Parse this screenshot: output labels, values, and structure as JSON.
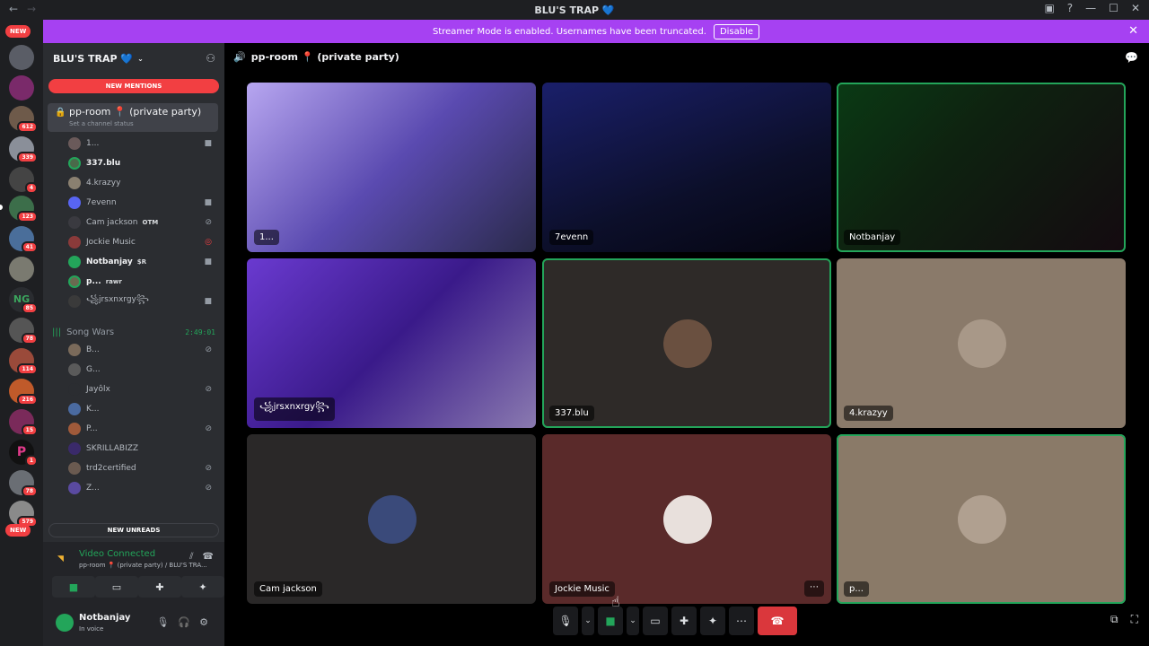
{
  "titlebar": {
    "title": "BLU'S TRAP 💙",
    "back": "←",
    "forward": "→",
    "icons": [
      "inbox-icon",
      "help-icon",
      "minimize-icon",
      "maximize-icon",
      "close-icon"
    ]
  },
  "banner": {
    "text": "Streamer Mode is enabled. Usernames have been truncated.",
    "button": "Disable",
    "close": "✕"
  },
  "guild_bar": {
    "new_top": "NEW",
    "new_bottom": "NEW",
    "badges": [
      "612",
      "339",
      "4",
      "123",
      "41",
      "85",
      "78",
      "114",
      "216",
      "15",
      "1",
      "78",
      "579"
    ]
  },
  "sidebar": {
    "server_name": "BLU'S TRAP 💙",
    "new_mentions": "NEW MENTIONS",
    "current_channel": {
      "name": "pp-room 📍 (private party)",
      "status": "Set a channel status"
    },
    "voice_users": [
      {
        "name": "1...",
        "tag": ""
      },
      {
        "name": "337.blu",
        "tag": ""
      },
      {
        "name": "4.krazyy",
        "tag": ""
      },
      {
        "name": "7evenn",
        "tag": ""
      },
      {
        "name": "Cam jackson",
        "tag": "OTM"
      },
      {
        "name": "Jockie Music",
        "tag": ""
      },
      {
        "name": "Notbanjay",
        "tag": "$R"
      },
      {
        "name": "p...",
        "tag": "rawr"
      },
      {
        "name": "꧁jrsxnxrgy꧂",
        "tag": ""
      }
    ],
    "song_wars": {
      "name": "Song Wars",
      "time": "2:49:01"
    },
    "song_wars_users": [
      {
        "name": "B..."
      },
      {
        "name": "G..."
      },
      {
        "name": "Jayôlx"
      },
      {
        "name": "K..."
      },
      {
        "name": "P..."
      },
      {
        "name": "SKRILLABIZZ"
      },
      {
        "name": "trd2certified"
      },
      {
        "name": "Z..."
      }
    ],
    "new_unreads": "NEW UNREADS"
  },
  "rtc": {
    "status": "Video Connected",
    "channel": "pp-room 📍 (private party) / BLU'S TRA..."
  },
  "user": {
    "name": "Notbanjay",
    "status": "In voice"
  },
  "stage": {
    "channel": "pp-room 📍 (private party)",
    "tiles": [
      {
        "label": "1...",
        "kind": "video"
      },
      {
        "label": "7evenn",
        "kind": "video"
      },
      {
        "label": "Notbanjay",
        "kind": "video"
      },
      {
        "label": "꧁jrsxnxrgy꧂",
        "kind": "video"
      },
      {
        "label": "337.blu",
        "kind": "avatar"
      },
      {
        "label": "4.krazyy",
        "kind": "avatar"
      },
      {
        "label": "Cam jackson",
        "kind": "avatar"
      },
      {
        "label": "Jockie Music",
        "kind": "avatar"
      },
      {
        "label": "p...",
        "kind": "avatar"
      }
    ],
    "more": "⋯"
  },
  "colors": {
    "accent_green": "#23a55a",
    "banner_purple": "#a641f2",
    "danger": "#da373c"
  }
}
